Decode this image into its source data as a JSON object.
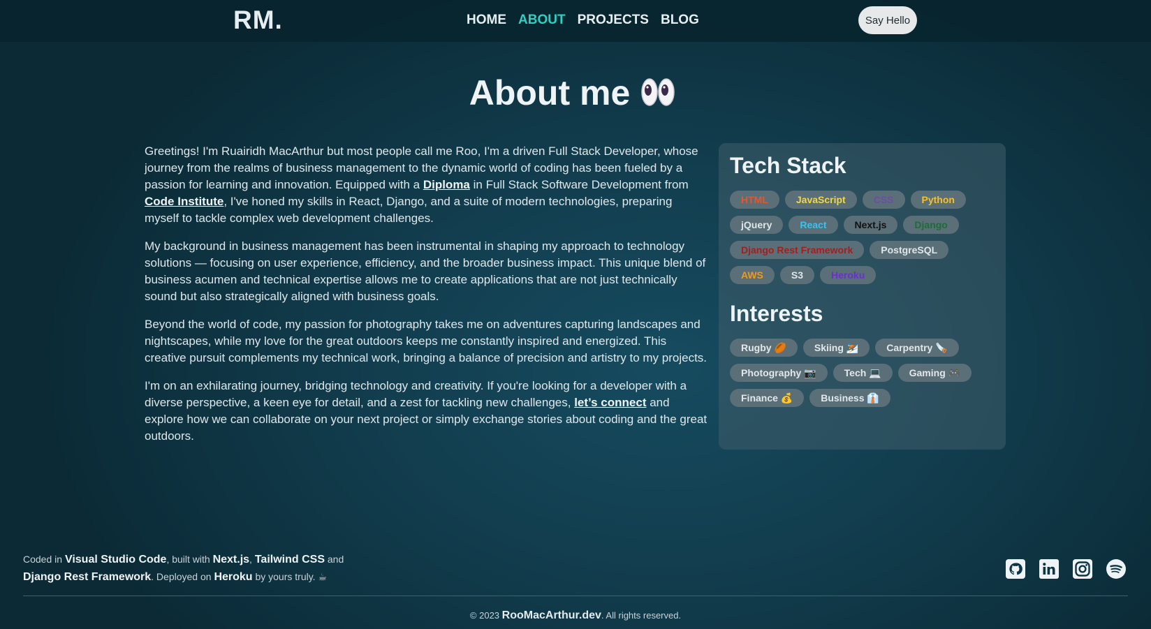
{
  "nav": {
    "logo": "RM.",
    "links": [
      "HOME",
      "ABOUT",
      "PROJECTS",
      "BLOG"
    ],
    "active": "ABOUT",
    "cta": "Say Hello"
  },
  "page": {
    "title": "About me",
    "title_emoji": "👀"
  },
  "bio": {
    "p1": {
      "a": "Greetings! I'm Ruairidh MacArthur but most people call me Roo, I'm a driven Full Stack Developer, whose journey from the realms of business management to the dynamic world of coding has been fueled by a passion for learning and innovation. Equipped with a ",
      "link1": "Diploma",
      "b": " in Full Stack Software Development from ",
      "link2": "Code Institute",
      "c": ", I've honed my skills in React, Django, and a suite of modern technologies, preparing myself to tackle complex web development challenges."
    },
    "p2": "My background in business management has been instrumental in shaping my approach to technology solutions — focusing on user experience, efficiency, and the broader business impact. This unique blend of business acumen and technical expertise allows me to create applications that are not just technically sound but also strategically aligned with business goals.",
    "p3": "Beyond the world of code, my passion for photography takes me on adventures capturing landscapes and nightscapes, while my love for the great outdoors keeps me constantly inspired and energized. This creative pursuit complements my technical work, bringing a balance of precision and artistry to my projects.",
    "p4": {
      "a": "I'm on an exhilarating journey, bridging technology and creativity. If you're looking for a developer with a diverse perspective, a keen eye for detail, and a zest for tackling new challenges, ",
      "link": "let’s connect",
      "b": " and explore how we can collaborate on your next project or simply exchange stories about coding and the great outdoors."
    }
  },
  "tech_stack": {
    "heading": "Tech Stack",
    "items": [
      {
        "label": "HTML",
        "color": "#e4572e"
      },
      {
        "label": "JavaScript",
        "color": "#f0d84a"
      },
      {
        "label": "CSS",
        "color": "#6b4fa0"
      },
      {
        "label": "Python",
        "color": "#f2c12e"
      },
      {
        "label": "jQuery",
        "color": "#dfe6e9"
      },
      {
        "label": "React",
        "color": "#38c3f0"
      },
      {
        "label": "Next.js",
        "color": "#111111"
      },
      {
        "label": "Django",
        "color": "#1f6b3a"
      },
      {
        "label": "Django Rest Framework",
        "color": "#a31f1f"
      },
      {
        "label": "PostgreSQL",
        "color": "#dfe6e9"
      },
      {
        "label": "AWS",
        "color": "#f09a1a"
      },
      {
        "label": "S3",
        "color": "#dfe6e9"
      },
      {
        "label": "Heroku",
        "color": "#6a2fd1"
      }
    ]
  },
  "interests": {
    "heading": "Interests",
    "items": [
      "Rugby 🏉",
      "Skiing ⛷️",
      "Carpentry 🪚",
      "Photography 📷",
      "Tech 💻",
      "Gaming 🎮",
      "Finance 💰",
      "Business 👔"
    ]
  },
  "footer": {
    "coded_in": "Coded in",
    "vscode": "Visual Studio Code",
    "built_with": ", built with",
    "nextjs": "Next.js",
    "comma": ",",
    "tailwind": "Tailwind CSS",
    "and": "and",
    "drf": "Django Rest Framework",
    "deployed_on": ". Deployed on",
    "heroku": "Heroku",
    "by": "by yours truly. ☕",
    "copyright_prefix": "© 2023",
    "site": "RooMacArthur.dev",
    "copyright_suffix": ". All rights reserved.",
    "social_icons": [
      "github-icon",
      "linkedin-icon",
      "instagram-icon",
      "spotify-icon"
    ]
  }
}
